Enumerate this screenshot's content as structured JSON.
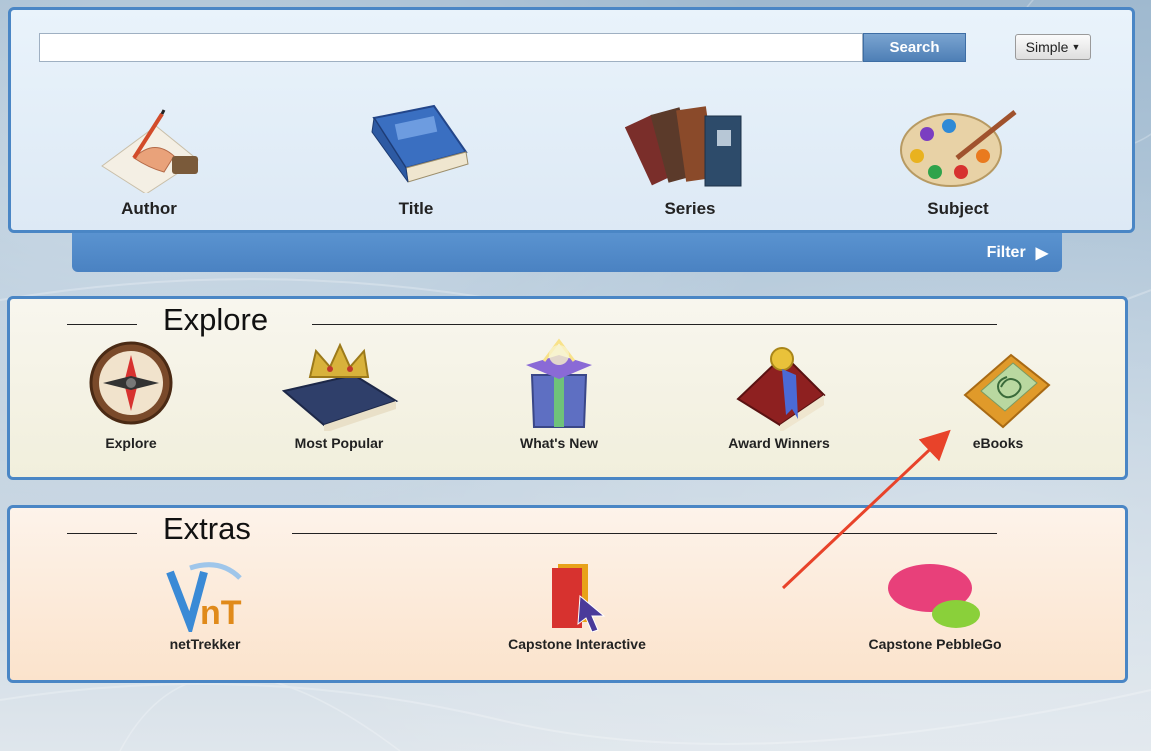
{
  "search": {
    "input_value": "",
    "button_label": "Search",
    "mode_select": "Simple"
  },
  "search_tiles": [
    {
      "label": "Author",
      "icon": "author-hand-writing-icon"
    },
    {
      "label": "Title",
      "icon": "blue-book-icon"
    },
    {
      "label": "Series",
      "icon": "book-stack-icon"
    },
    {
      "label": "Subject",
      "icon": "paint-palette-icon"
    }
  ],
  "filter": {
    "label": "Filter"
  },
  "explore": {
    "heading": "Explore",
    "items": [
      {
        "label": "Explore",
        "icon": "compass-icon"
      },
      {
        "label": "Most Popular",
        "icon": "crowned-book-icon"
      },
      {
        "label": "What's New",
        "icon": "gift-box-icon"
      },
      {
        "label": "Award Winners",
        "icon": "ribbon-book-icon"
      },
      {
        "label": "eBooks",
        "icon": "ebook-reader-icon"
      }
    ]
  },
  "extras": {
    "heading": "Extras",
    "items": [
      {
        "label": "netTrekker",
        "icon": "nettrekker-logo-icon"
      },
      {
        "label": "Capstone Interactive",
        "icon": "capstone-book-cursor-icon"
      },
      {
        "label": "Capstone PebbleGo",
        "icon": "pebblego-logo-icon"
      }
    ]
  },
  "annotation": {
    "color": "#e8432a",
    "points_to": "eBooks"
  }
}
